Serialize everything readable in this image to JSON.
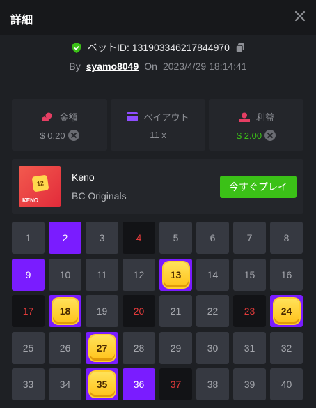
{
  "header": {
    "title": "詳細"
  },
  "bet": {
    "id_label": "ベットID: 131903346217844970",
    "by_label": "By",
    "user": "syamo8049",
    "on_label": "On",
    "date": "2023/4/29 18:14:41"
  },
  "stats": {
    "amount": {
      "label": "金額",
      "value": "$ 0.20"
    },
    "payout": {
      "label": "ペイアウト",
      "value": "11 x"
    },
    "profit": {
      "label": "利益",
      "value": "$ 2.00"
    }
  },
  "game": {
    "name": "Keno",
    "provider": "BC Originals",
    "play_label": "今すぐプレイ",
    "thumb_text": "KENO",
    "thumb_number": "12"
  },
  "colors": {
    "accent": "#7a1cff",
    "green": "#3bc117",
    "red": "#e03a3a",
    "gold": "#ffd84d"
  },
  "keno": {
    "numbers": [
      "1",
      "2",
      "3",
      "4",
      "5",
      "6",
      "7",
      "8",
      "9",
      "10",
      "11",
      "12",
      "13",
      "14",
      "15",
      "16",
      "17",
      "18",
      "19",
      "20",
      "21",
      "22",
      "23",
      "24",
      "25",
      "26",
      "27",
      "28",
      "29",
      "30",
      "31",
      "32",
      "33",
      "34",
      "35",
      "36",
      "37",
      "38",
      "39",
      "40"
    ],
    "picked": [
      "2",
      "9",
      "36"
    ],
    "drawn": [
      "4",
      "17",
      "20",
      "23",
      "37"
    ],
    "hits": [
      "13",
      "18",
      "24",
      "27",
      "35"
    ]
  }
}
